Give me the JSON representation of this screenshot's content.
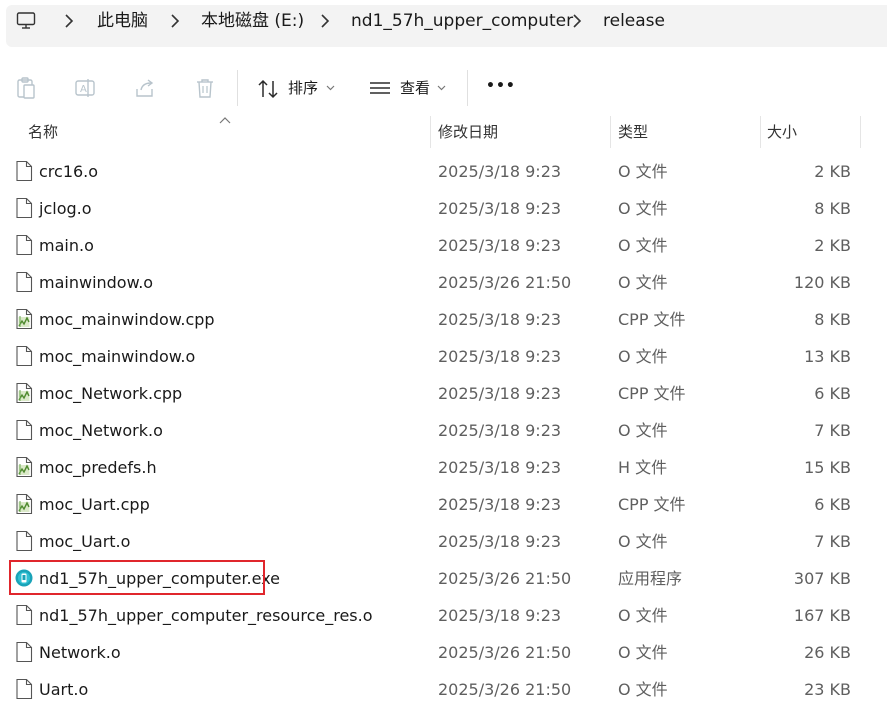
{
  "breadcrumb": [
    "此电脑",
    "本地磁盘 (E:)",
    "nd1_57h_upper_computer",
    "release"
  ],
  "toolbar": {
    "sort_label": "排序",
    "view_label": "查看",
    "more_label": "•••"
  },
  "columns": {
    "name": "名称",
    "date": "修改日期",
    "type": "类型",
    "size": "大小"
  },
  "files": [
    {
      "name": "crc16.o",
      "date": "2025/3/18 9:23",
      "type": "O 文件",
      "size": "2 KB",
      "icon": "blank-file-icon"
    },
    {
      "name": "jclog.o",
      "date": "2025/3/18 9:23",
      "type": "O 文件",
      "size": "8 KB",
      "icon": "blank-file-icon"
    },
    {
      "name": "main.o",
      "date": "2025/3/18 9:23",
      "type": "O 文件",
      "size": "2 KB",
      "icon": "blank-file-icon"
    },
    {
      "name": "mainwindow.o",
      "date": "2025/3/26 21:50",
      "type": "O 文件",
      "size": "120 KB",
      "icon": "blank-file-icon"
    },
    {
      "name": "moc_mainwindow.cpp",
      "date": "2025/3/18 9:23",
      "type": "CPP 文件",
      "size": "8 KB",
      "icon": "source-file-icon"
    },
    {
      "name": "moc_mainwindow.o",
      "date": "2025/3/18 9:23",
      "type": "O 文件",
      "size": "13 KB",
      "icon": "blank-file-icon"
    },
    {
      "name": "moc_Network.cpp",
      "date": "2025/3/18 9:23",
      "type": "CPP 文件",
      "size": "6 KB",
      "icon": "source-file-icon"
    },
    {
      "name": "moc_Network.o",
      "date": "2025/3/18 9:23",
      "type": "O 文件",
      "size": "7 KB",
      "icon": "blank-file-icon"
    },
    {
      "name": "moc_predefs.h",
      "date": "2025/3/18 9:23",
      "type": "H 文件",
      "size": "15 KB",
      "icon": "source-file-icon"
    },
    {
      "name": "moc_Uart.cpp",
      "date": "2025/3/18 9:23",
      "type": "CPP 文件",
      "size": "6 KB",
      "icon": "source-file-icon"
    },
    {
      "name": "moc_Uart.o",
      "date": "2025/3/18 9:23",
      "type": "O 文件",
      "size": "7 KB",
      "icon": "blank-file-icon"
    },
    {
      "name": "nd1_57h_upper_computer.exe",
      "date": "2025/3/26 21:50",
      "type": "应用程序",
      "size": "307 KB",
      "icon": "app-exe-icon"
    },
    {
      "name": "nd1_57h_upper_computer_resource_res.o",
      "date": "2025/3/18 9:23",
      "type": "O 文件",
      "size": "167 KB",
      "icon": "blank-file-icon"
    },
    {
      "name": "Network.o",
      "date": "2025/3/26 21:50",
      "type": "O 文件",
      "size": "26 KB",
      "icon": "blank-file-icon"
    },
    {
      "name": "Uart.o",
      "date": "2025/3/26 21:50",
      "type": "O 文件",
      "size": "23 KB",
      "icon": "blank-file-icon"
    }
  ],
  "colors": {
    "highlight": "#e0262c",
    "exe_icon": "#1aa3b8",
    "source_icon_green": "#6aa84f"
  }
}
